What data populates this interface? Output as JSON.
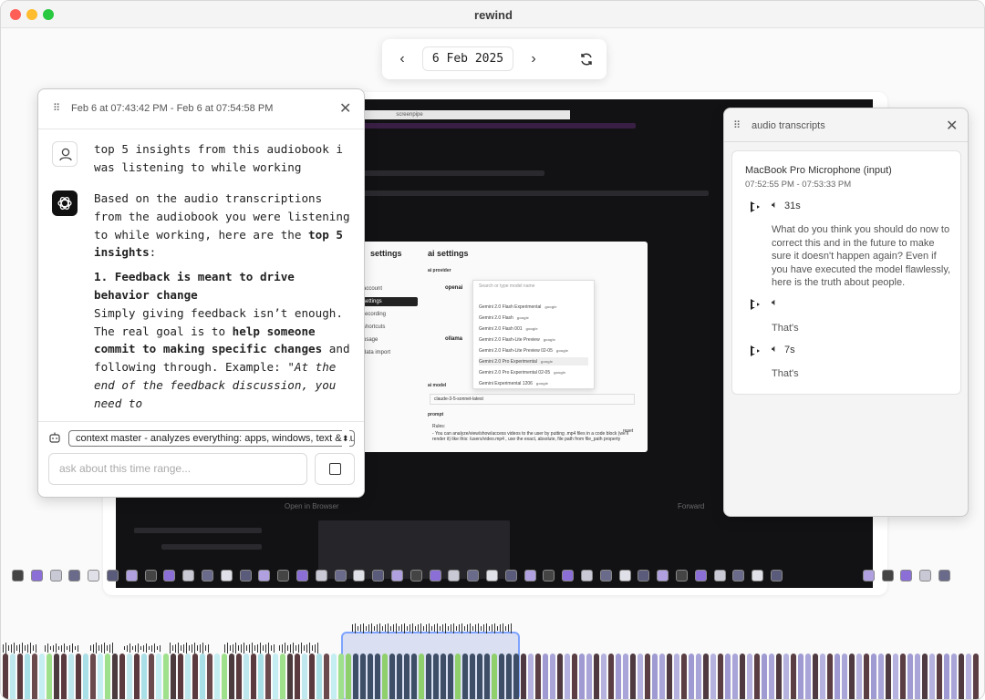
{
  "window": {
    "title": "rewind",
    "traffic_colors": [
      "#ff5f57",
      "#febc2e",
      "#28c840"
    ]
  },
  "datebar": {
    "prev_icon": "chevron-left",
    "next_icon": "chevron-right",
    "refresh_icon": "refresh",
    "date": "6 Feb 2025"
  },
  "chat": {
    "range": "Feb 6 at 07:43:42 PM - Feb 6 at 07:54:58 PM",
    "user_message": "top 5 insights from this audiobook i was listening to while working",
    "assistant": {
      "intro_1": "Based on the audio transcriptions from the audiobook you were listening to while working, here are the ",
      "intro_bold": "top 5 insights",
      "intro_2": ":",
      "point1_title": "1. Feedback is meant to drive behavior change",
      "point1_a": "Simply giving feedback isn’t enough. The real goal is to ",
      "point1_bold": "help someone commit to making specific changes",
      "point1_b": " and following through. Example: ",
      "point1_quote": "\"At the end of the feedback discussion, you need to"
    },
    "agent_select": "context master - analyzes everything: apps, windows, text & au",
    "ask_placeholder": "ask about this time range..."
  },
  "audio": {
    "title": "audio transcripts",
    "device": "MacBook Pro Microphone (input)",
    "times": "07:52:55 PM - 07:53:33 PM",
    "items": [
      {
        "duration": "31s",
        "text": "What do you think you should do now to correct this and in the future to make sure it doesn't happen again? Even if you have executed the model flawlessly, here is the truth about people."
      },
      {
        "duration": "",
        "text": "That's"
      },
      {
        "duration": "7s",
        "text": "That's"
      }
    ]
  },
  "screen": {
    "inner_title": "screenpipe",
    "settings_title": "settings",
    "ai_settings": "ai settings",
    "ai_provider": "ai provider",
    "provider_openai": "openai",
    "provider_ollama": "ollama",
    "search_placeholder": "Search or type model name",
    "models": [
      {
        "name": "Gemini 2.0 Flash Experimental",
        "tag": "google"
      },
      {
        "name": "Gemini 2.0 Flash",
        "tag": "google"
      },
      {
        "name": "Gemini 2.0 Flash 001",
        "tag": "google"
      },
      {
        "name": "Gemini 2.0 Flash-Lite Preview",
        "tag": "google"
      },
      {
        "name": "Gemini 2.0 Flash-Lite Preview 02-05",
        "tag": "google"
      },
      {
        "name": "Gemini 2.0 Pro Experimental",
        "tag": "google"
      },
      {
        "name": "Gemini 2.0 Pro Experimental 02-05",
        "tag": "google"
      },
      {
        "name": "Gemini Experimental 1206",
        "tag": "google"
      }
    ],
    "side_items": [
      "account",
      "settings",
      "recording",
      "shortcuts",
      "usage",
      "data import"
    ],
    "ai_model": "ai model",
    "model_value": "claude-3-5-sonnet-latest",
    "prompt_label": "prompt",
    "reset_label": "reset",
    "rules_label": "Rules:",
    "rules_text": "- You can analyze/view/show/access videos to the user by putting .mp4 files in a code block (we'll render it) like this: /users/video.mp4 , use the exact, absolute, file path from file_path property",
    "open_in_browser": "Open in Browser",
    "forward": "Forward"
  }
}
